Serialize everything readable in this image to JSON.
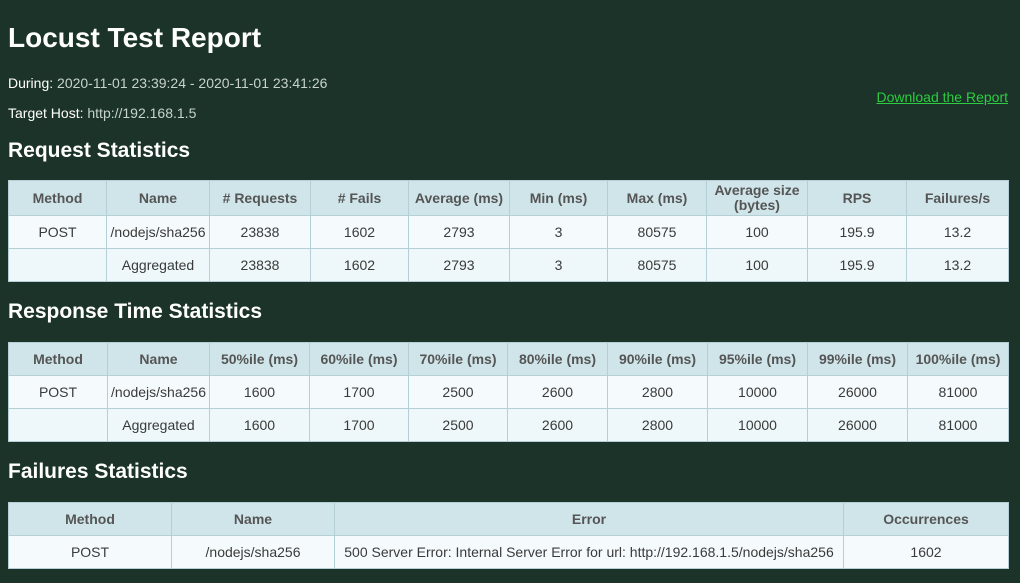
{
  "title": "Locust Test Report",
  "during": {
    "label": "During:",
    "value": "2020-11-01 23:39:24 - 2020-11-01 23:41:26"
  },
  "target": {
    "label": "Target Host:",
    "value": "http://192.168.1.5"
  },
  "download_label": "Download the Report",
  "request_stats": {
    "heading": "Request Statistics",
    "columns": [
      "Method",
      "Name",
      "# Requests",
      "# Fails",
      "Average (ms)",
      "Min (ms)",
      "Max (ms)",
      "Average size",
      "(bytes)",
      "RPS",
      "Failures/s"
    ],
    "rows": [
      [
        "POST",
        "/nodejs/sha256",
        "23838",
        "1602",
        "2793",
        "3",
        "80575",
        "100",
        "195.9",
        "13.2"
      ],
      [
        "",
        "Aggregated",
        "23838",
        "1602",
        "2793",
        "3",
        "80575",
        "100",
        "195.9",
        "13.2"
      ]
    ]
  },
  "response_stats": {
    "heading": "Response Time Statistics",
    "columns": [
      "Method",
      "Name",
      "50%ile (ms)",
      "60%ile (ms)",
      "70%ile (ms)",
      "80%ile (ms)",
      "90%ile (ms)",
      "95%ile (ms)",
      "99%ile (ms)",
      "100%ile (ms)"
    ],
    "rows": [
      [
        "POST",
        "/nodejs/sha256",
        "1600",
        "1700",
        "2500",
        "2600",
        "2800",
        "10000",
        "26000",
        "81000"
      ],
      [
        "",
        "Aggregated",
        "1600",
        "1700",
        "2500",
        "2600",
        "2800",
        "10000",
        "26000",
        "81000"
      ]
    ]
  },
  "failures_stats": {
    "heading": "Failures Statistics",
    "columns": [
      "Method",
      "Name",
      "Error",
      "Occurrences"
    ],
    "rows": [
      [
        "POST",
        "/nodejs/sha256",
        "500 Server Error: Internal Server Error for url: http://192.168.1.5/nodejs/sha256",
        "1602"
      ]
    ]
  },
  "colors": {
    "background": "#1b3329",
    "header_bg": "#cfe5ea",
    "link": "#2ecc40"
  }
}
